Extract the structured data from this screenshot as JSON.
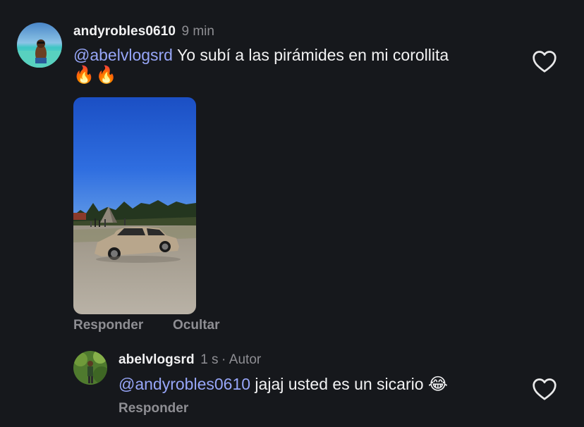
{
  "comment": {
    "username": "andyrobles0610",
    "time": "9 min",
    "mention": "@abelvlogsrd",
    "text": " Yo subí a las pirámides en mi corollita",
    "emoji_line": "🔥🔥",
    "photo_icon": "photo-car-pyramids",
    "actions": {
      "reply": "Responder",
      "hide": "Ocultar"
    },
    "like_icon": "heart-outline-icon"
  },
  "reply": {
    "username": "abelvlogsrd",
    "time": "1 s",
    "separator": "·",
    "author_badge": "Autor",
    "mention": "@andyrobles0610",
    "text": " jajaj usted es un sicario",
    "emoji": "😂",
    "actions": {
      "reply": "Responder"
    },
    "like_icon": "heart-outline-icon"
  },
  "colors": {
    "background": "#16181c",
    "mention": "#97a6f8",
    "secondary": "#8e8e93"
  }
}
